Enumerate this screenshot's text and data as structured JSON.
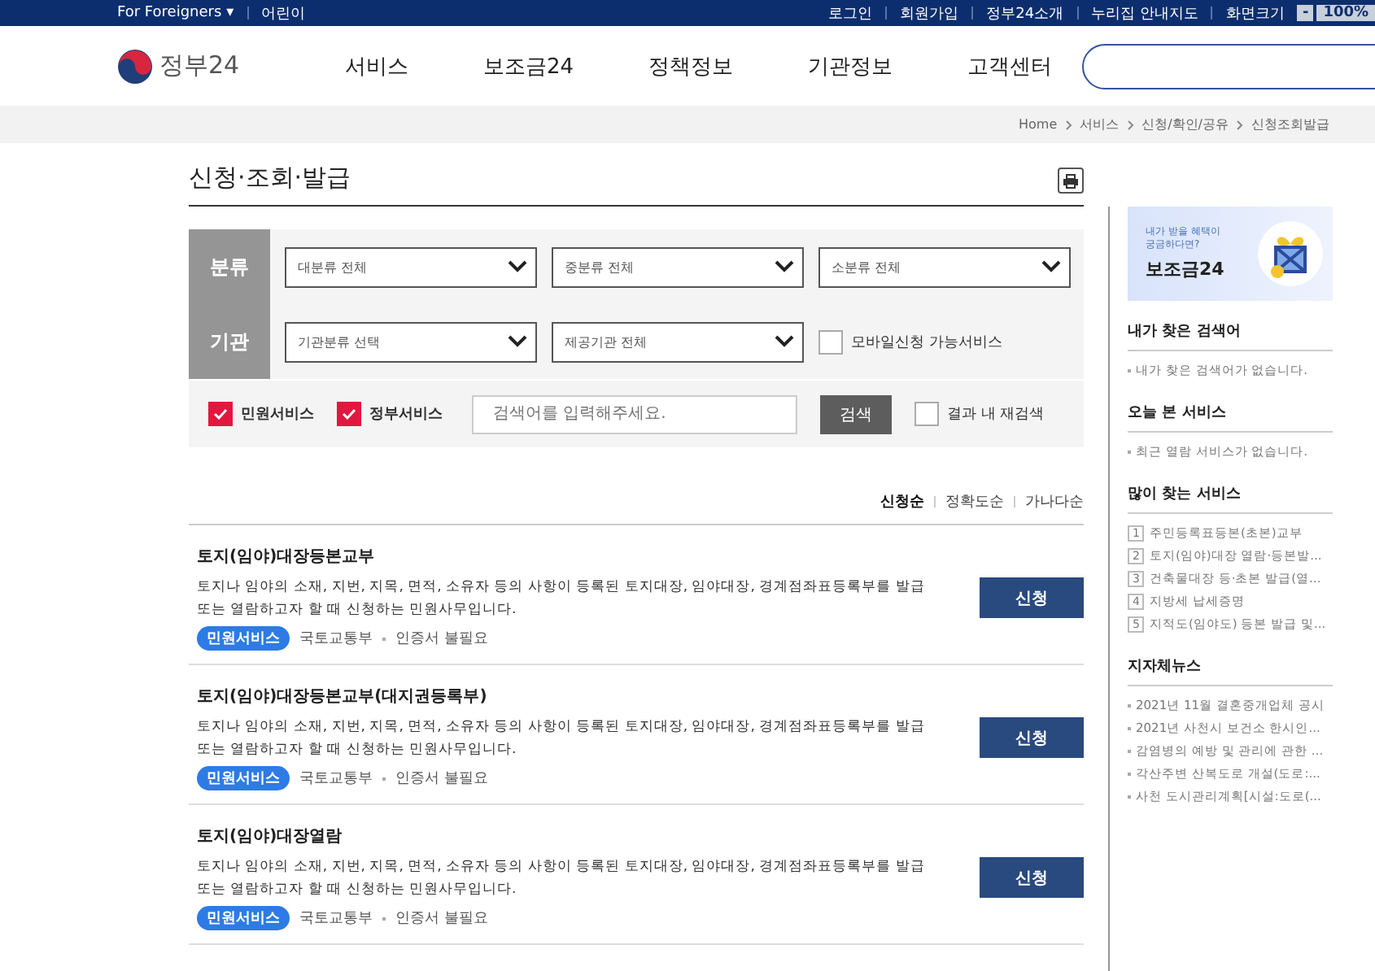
{
  "top_bar": {
    "left": [
      {
        "label": "For Foreigners",
        "caret": "▾"
      },
      {
        "label": "어린이"
      }
    ],
    "right": [
      "로그인",
      "회원가입",
      "정부24소개",
      "누리집 안내지도"
    ],
    "zoom": {
      "label": "화면크기",
      "minus": "-",
      "value": "100%"
    }
  },
  "header": {
    "logo": "정부24",
    "nav": [
      "서비스",
      "보조금24",
      "정책정보",
      "기관정보",
      "고객센터"
    ]
  },
  "breadcrumb": [
    "Home",
    "서비스",
    "신청/확인/공유",
    "신청조회발급"
  ],
  "page_title": "신청·조회·발급",
  "filters": {
    "rows": [
      {
        "label": "분류",
        "selects": [
          "대분류 전체",
          "중분류 전체",
          "소분류 전체"
        ]
      },
      {
        "label": "기관",
        "selects": [
          "기관분류 선택",
          "제공기관 전체"
        ],
        "checkbox": {
          "label": "모바일신청 가능서비스",
          "checked": false
        }
      }
    ],
    "types": [
      {
        "label": "민원서비스",
        "checked": true
      },
      {
        "label": "정부서비스",
        "checked": true
      }
    ],
    "search": {
      "placeholder": "검색어를 입력해주세요."
    },
    "search_button": "검색",
    "refine": {
      "label": "결과 내 재검색",
      "checked": false
    }
  },
  "sort": [
    {
      "label": "신청순",
      "selected": true
    },
    {
      "label": "정확도순",
      "selected": false
    },
    {
      "label": "가나다순",
      "selected": false
    }
  ],
  "results": [
    {
      "title": "토지(임야)대장등본교부",
      "description": "토지나 임야의 소재, 지번, 지목, 면적, 소유자 등의 사항이 등록된 토지대장, 임야대장, 경계점좌표등록부를 발급 또는 열람하고자 할 때 신청하는 민원사무입니다.",
      "tag": "민원서비스",
      "agency": "국토교통부",
      "auth": "인증서 불필요",
      "button": "신청"
    },
    {
      "title": "토지(임야)대장등본교부(대지권등록부)",
      "description": "토지나 임야의 소재, 지번, 지목, 면적, 소유자 등의 사항이 등록된 토지대장, 임야대장, 경계점좌표등록부를 발급 또는 열람하고자 할 때 신청하는 민원사무입니다.",
      "tag": "민원서비스",
      "agency": "국토교통부",
      "auth": "인증서 불필요",
      "button": "신청"
    },
    {
      "title": "토지(임야)대장열람",
      "description": "토지나 임야의 소재, 지번, 지목, 면적, 소유자 등의 사항이 등록된 토지대장, 임야대장, 경계점좌표등록부를 발급 또는 열람하고자 할 때 신청하는 민원사무입니다.",
      "tag": "민원서비스",
      "agency": "국토교통부",
      "auth": "인증서 불필요",
      "button": "신청"
    }
  ],
  "sidebar": {
    "banner": {
      "line1": "내가 받을 혜택이",
      "line2": "궁금하다면?",
      "brand": "보조금24"
    },
    "sections": [
      {
        "title": "내가 찾은 검색어",
        "kind": "note",
        "items": [
          {
            "text": "내가 찾은 검색어가 없습니다."
          }
        ]
      },
      {
        "title": "오늘 본 서비스",
        "kind": "note",
        "items": [
          {
            "text": "최근 열람 서비스가 없습니다."
          }
        ]
      },
      {
        "title": "많이 찾는 서비스",
        "kind": "ranked",
        "items": [
          {
            "rank": "1",
            "text": "주민등록표등본(초본)교부"
          },
          {
            "rank": "2",
            "text": "토지(임야)대장 열람·등본발..."
          },
          {
            "rank": "3",
            "text": "건축물대장 등·초본 발급(열..."
          },
          {
            "rank": "4",
            "text": "지방세 납세증명"
          },
          {
            "rank": "5",
            "text": "지적도(임야도) 등본 발급 및..."
          }
        ]
      },
      {
        "title": "지자체뉴스",
        "kind": "note",
        "items": [
          {
            "text": "2021년 11월 결혼중개업체 공시"
          },
          {
            "text": "2021년 사천시 보건소 한시인..."
          },
          {
            "text": "감염병의 예방 및 관리에 관한 ..."
          },
          {
            "text": "각산주변 산복도로 개설(도로:..."
          },
          {
            "text": "사천 도시관리계획[시설:도로(..."
          }
        ]
      }
    ]
  }
}
